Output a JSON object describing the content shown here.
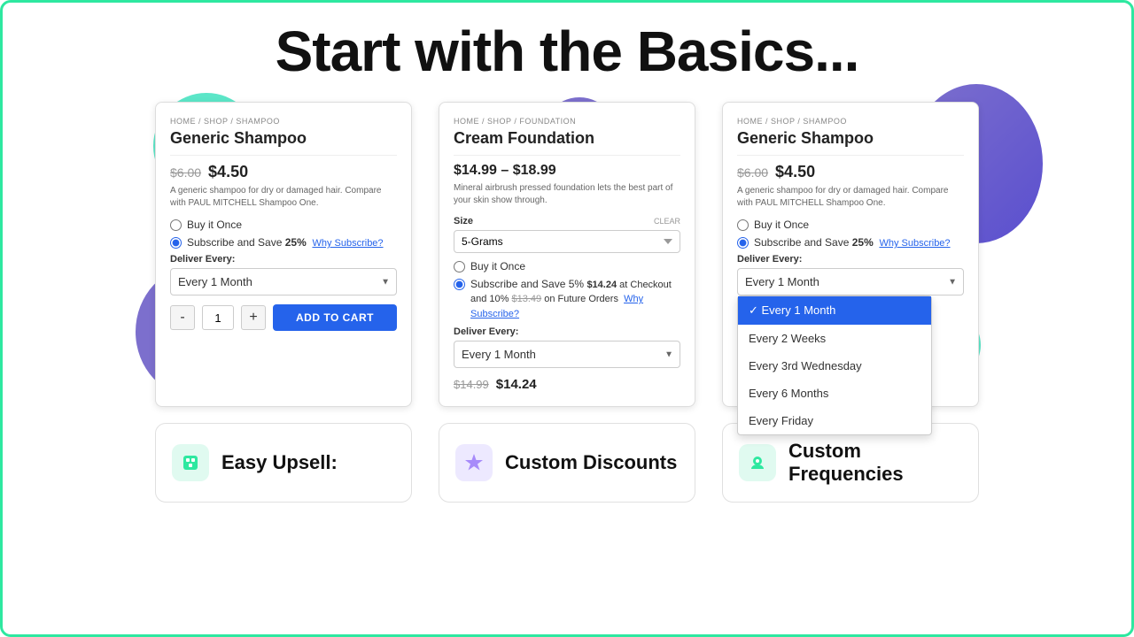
{
  "page": {
    "title": "Start with the Basics...",
    "border_color": "#2ee8a0"
  },
  "card1": {
    "breadcrumb": "HOME / SHOP / SHAMPOO",
    "product_name": "Generic Shampoo",
    "price_original": "$6.00",
    "price_sale": "$4.50",
    "description": "A generic shampoo for dry or damaged hair. Compare with PAUL MITCHELL Shampoo One.",
    "option_once": "Buy it Once",
    "option_subscribe": "Subscribe and Save",
    "save_pct": "25%",
    "why_link": "Why Subscribe?",
    "deliver_label": "Deliver Every:",
    "frequency": "Every 1 Month",
    "qty_minus": "-",
    "qty_value": "1",
    "qty_plus": "+",
    "add_to_cart": "ADD TO CART"
  },
  "card2": {
    "breadcrumb": "HOME / SHOP / FOUNDATION",
    "product_name": "Cream Foundation",
    "price_range": "$14.99 – $18.99",
    "description": "Mineral airbrush pressed foundation lets the best part of your skin show through.",
    "size_label": "Size",
    "clear_label": "CLEAR",
    "size_value": "5-Grams",
    "option_once": "Buy it Once",
    "option_subscribe": "Subscribe and Save 5%",
    "subscribe_detail": "$14.24 at Checkout and 10% $13.49 on Future Orders",
    "why_link": "Why Subscribe?",
    "deliver_label": "Deliver Every:",
    "frequency": "Every 1 Month",
    "final_price_original": "$14.99",
    "final_price_sale": "$14.24"
  },
  "card3": {
    "breadcrumb": "HOME / SHOP / SHAMPOO",
    "product_name": "Generic Shampoo",
    "price_original": "$6.00",
    "price_sale": "$4.50",
    "description": "A generic shampoo for dry or damaged hair. Compare with PAUL MITCHELL Shampoo One.",
    "option_once": "Buy it Once",
    "option_subscribe": "Subscribe and Save",
    "save_pct": "25%",
    "why_link": "Why Subscribe?",
    "deliver_label": "Deliver Every:",
    "dropdown_options": [
      {
        "label": "Every 1 Month",
        "selected": true
      },
      {
        "label": "Every 2 Weeks",
        "selected": false
      },
      {
        "label": "Every 3rd Wednesday",
        "selected": false
      },
      {
        "label": "Every 6 Months",
        "selected": false
      },
      {
        "label": "Every Friday",
        "selected": false
      }
    ]
  },
  "features": [
    {
      "icon": "🟩",
      "icon_type": "green",
      "label": "Easy Upsell:"
    },
    {
      "icon": "🏷️",
      "icon_type": "purple",
      "label": "Custom Discounts"
    },
    {
      "icon": "📍",
      "icon_type": "green2",
      "label": "Custom Frequencies"
    }
  ]
}
